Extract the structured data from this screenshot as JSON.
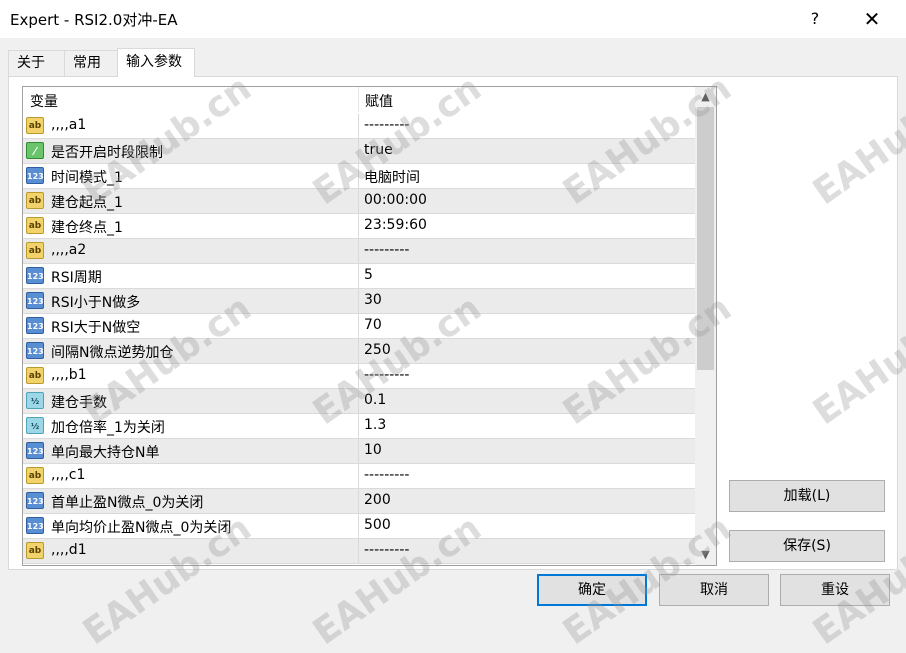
{
  "window": {
    "title": "Expert - RSI2.0对冲-EA",
    "help_label": "?",
    "close_label": "✕"
  },
  "tabs": [
    "关于",
    "常用",
    "输入参数"
  ],
  "grid": {
    "col_variable": "变量",
    "col_value": "赋值",
    "rows": [
      {
        "type": "ab",
        "icon": "string-type-icon",
        "name": ",,,,a1",
        "value": "---------"
      },
      {
        "type": "bool",
        "icon": "bool-type-icon",
        "name": "是否开启时段限制",
        "value": "true"
      },
      {
        "type": "num",
        "icon": "int-type-icon",
        "name": "时间模式_1",
        "value": "电脑时间"
      },
      {
        "type": "ab",
        "icon": "string-type-icon",
        "name": "建仓起点_1",
        "value": "00:00:00"
      },
      {
        "type": "ab",
        "icon": "string-type-icon",
        "name": "建仓终点_1",
        "value": "23:59:60"
      },
      {
        "type": "ab",
        "icon": "string-type-icon",
        "name": ",,,,a2",
        "value": "---------"
      },
      {
        "type": "num",
        "icon": "int-type-icon",
        "name": "RSI周期",
        "value": "5"
      },
      {
        "type": "num",
        "icon": "int-type-icon",
        "name": "RSI小于N做多",
        "value": "30"
      },
      {
        "type": "num",
        "icon": "int-type-icon",
        "name": "RSI大于N做空",
        "value": "70"
      },
      {
        "type": "num",
        "icon": "int-type-icon",
        "name": "间隔N微点逆势加仓",
        "value": "250"
      },
      {
        "type": "ab",
        "icon": "string-type-icon",
        "name": ",,,,b1",
        "value": "---------"
      },
      {
        "type": "dbl",
        "icon": "double-type-icon",
        "name": "建仓手数",
        "value": "0.1"
      },
      {
        "type": "dbl",
        "icon": "double-type-icon",
        "name": "加仓倍率_1为关闭",
        "value": "1.3"
      },
      {
        "type": "num",
        "icon": "int-type-icon",
        "name": "单向最大持仓N单",
        "value": "10"
      },
      {
        "type": "ab",
        "icon": "string-type-icon",
        "name": ",,,,c1",
        "value": "---------"
      },
      {
        "type": "num",
        "icon": "int-type-icon",
        "name": "首单止盈N微点_0为关闭",
        "value": "200"
      },
      {
        "type": "num",
        "icon": "int-type-icon",
        "name": "单向均价止盈N微点_0为关闭",
        "value": "500"
      },
      {
        "type": "ab",
        "icon": "string-type-icon",
        "name": ",,,,d1",
        "value": "---------"
      }
    ]
  },
  "icon_glyphs": {
    "ab": "ab",
    "num": "123",
    "bool": "⁄",
    "dbl": "½"
  },
  "buttons": {
    "load": "加载(L)",
    "save": "保存(S)",
    "ok": "确定",
    "cancel": "取消",
    "reset": "重设"
  },
  "watermark": "EAHub.cn",
  "colors": {
    "accent": "#0078d7",
    "alt_row": "#ebebeb"
  }
}
